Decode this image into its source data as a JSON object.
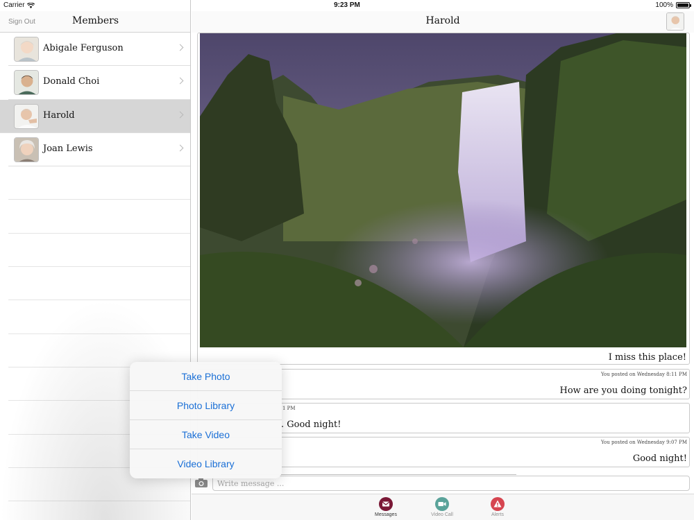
{
  "status_bar": {
    "carrier": "Carrier",
    "time": "9:23 PM",
    "battery": "100%"
  },
  "sidebar": {
    "sign_out_label": "Sign Out",
    "title": "Members",
    "members": [
      {
        "name": "Abigale Ferguson",
        "selected": false
      },
      {
        "name": "Donald Choi",
        "selected": false
      },
      {
        "name": "Harold",
        "selected": true
      },
      {
        "name": "Joan Lewis",
        "selected": false
      }
    ]
  },
  "conversation": {
    "title": "Harold",
    "photo_caption": "I miss this place!",
    "messages": [
      {
        "meta": "You posted on Wednesday 8:11 PM",
        "text": "How are you doing tonight?"
      },
      {
        "meta": "1 PM",
        "text": ". Good night!"
      },
      {
        "meta": "You posted on Wednesday 9:07 PM",
        "text": "Good night!"
      }
    ],
    "compose_placeholder": "Write message ..."
  },
  "tabs": [
    {
      "label": "Messages",
      "icon": "envelope-icon",
      "active": true,
      "color": "#7a1836"
    },
    {
      "label": "Video Call",
      "icon": "video-camera-icon",
      "active": false,
      "color": "#5aa39a"
    },
    {
      "label": "Alerts",
      "icon": "warning-icon",
      "active": false,
      "color": "#d64550"
    }
  ],
  "media_popover": {
    "items": [
      "Take Photo",
      "Photo Library",
      "Take Video",
      "Video Library"
    ]
  },
  "colors": {
    "link_blue": "#1a6fd6",
    "selected_row": "#d6d6d6"
  }
}
